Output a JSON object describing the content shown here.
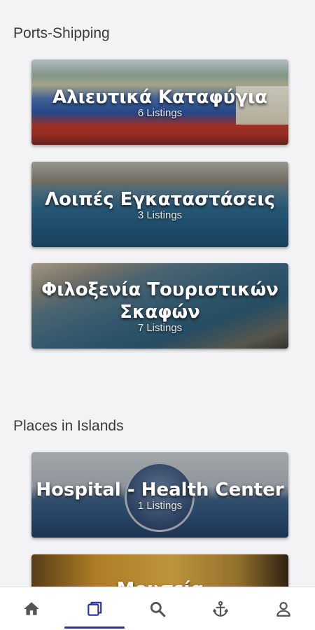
{
  "sections": [
    {
      "title": "Ports-Shipping",
      "cards": [
        {
          "title": "Αλιευτικά Καταφύγια",
          "count": "6 Listings"
        },
        {
          "title": "Λοιπές Εγκαταστάσεις",
          "count": "3 Listings"
        },
        {
          "title": "Φιλοξενία Τουριστικών Σκαφών",
          "count": "7 Listings"
        }
      ]
    },
    {
      "title": "Places in Islands",
      "cards": [
        {
          "title": "Hospital - Health Center",
          "count": "1 Listings"
        },
        {
          "title": "Μουσεία",
          "count": ""
        }
      ]
    }
  ],
  "bottom_nav": {
    "items": [
      {
        "icon": "home-icon"
      },
      {
        "icon": "listings-icon",
        "active": true
      },
      {
        "icon": "search-icon"
      },
      {
        "icon": "anchor-icon"
      },
      {
        "icon": "user-icon"
      }
    ],
    "active_color": "#2a2ea8",
    "icon_color": "#555555"
  }
}
